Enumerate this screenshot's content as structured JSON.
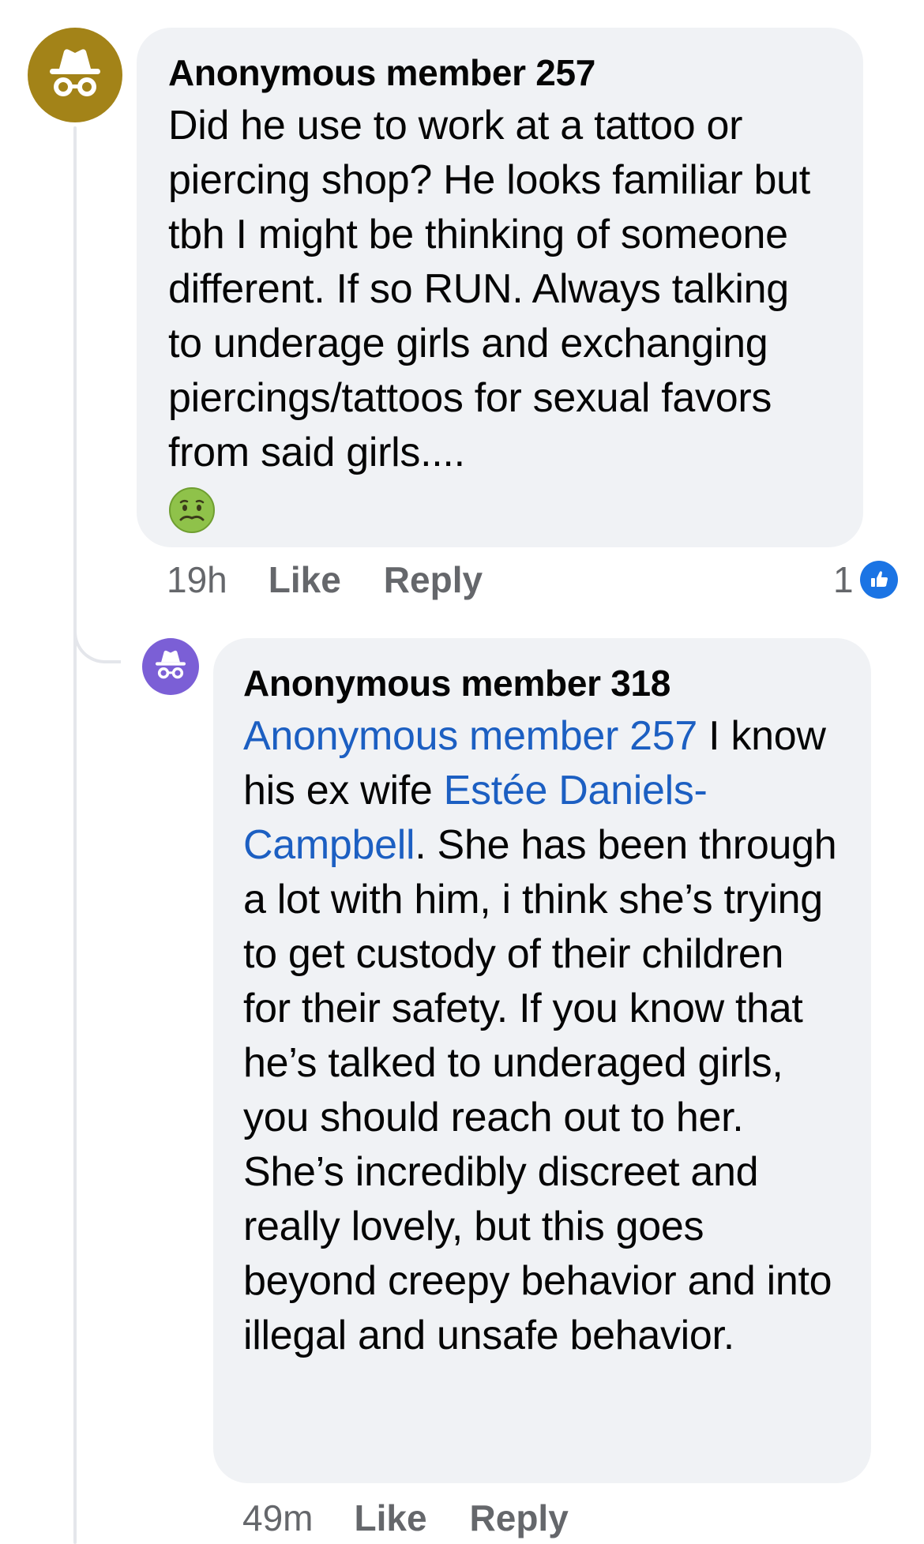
{
  "colors": {
    "avatar_1_bg": "#a38318",
    "avatar_2_bg": "#7b5fd6",
    "bubble_bg": "#f0f2f5",
    "mention": "#1c5fc2",
    "meta_text": "#65676b",
    "like_blue": "#1b74e4"
  },
  "comments": [
    {
      "avatar_icon": "incognito-icon",
      "author": "Anonymous member 257",
      "text": "Did he use to work at a tattoo or piercing shop? He looks familiar but tbh I might be thinking of someone different. If so RUN. Always talking to underage girls and exchanging piercings/tattoos for sexual favors from said girls....",
      "emoji": "nauseated-face-icon",
      "time": "19h",
      "like_label": "Like",
      "reply_label": "Reply",
      "reaction_count": "1",
      "reaction_icon": "thumbs-up-icon"
    },
    {
      "avatar_icon": "incognito-icon",
      "author": "Anonymous member 318",
      "mention_1": "Anonymous member 257",
      "text_1": " I know his ex wife ",
      "mention_2": "Estée Daniels-Campbell",
      "text_2": ". She has been through a lot with him, i think she’s trying to get custody of their children for their safety. If you know that he’s talked to underaged girls, you should reach out to her. She’s incredibly discreet and really lovely, but this goes beyond creepy behavior and into illegal and unsafe behavior.",
      "time": "49m",
      "like_label": "Like",
      "reply_label": "Reply"
    }
  ]
}
